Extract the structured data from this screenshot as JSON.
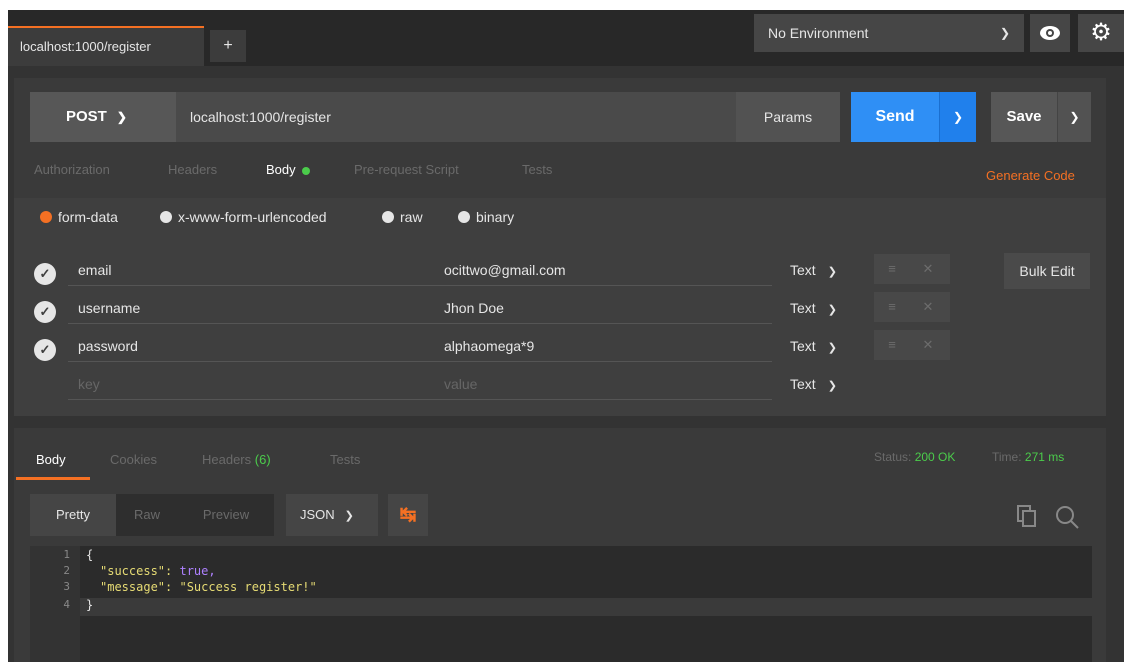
{
  "tabs": {
    "active_tab": "localhost:1000/register",
    "add_label": "+"
  },
  "environment": {
    "selected": "No Environment"
  },
  "request": {
    "method": "POST",
    "url": "localhost:1000/register",
    "params_label": "Params",
    "send_label": "Send",
    "save_label": "Save"
  },
  "request_tabs": [
    "Authorization",
    "Headers",
    "Body",
    "Pre-request Script",
    "Tests"
  ],
  "generate_code_label": "Generate Code",
  "body_modes": [
    "form-data",
    "x-www-form-urlencoded",
    "raw",
    "binary"
  ],
  "form_rows": [
    {
      "key": "email",
      "value": "ocittwo@gmail.com",
      "type": "Text"
    },
    {
      "key": "username",
      "value": "Jhon Doe",
      "type": "Text"
    },
    {
      "key": "password",
      "value": "alphaomega*9",
      "type": "Text"
    }
  ],
  "empty_row": {
    "key_placeholder": "key",
    "value_placeholder": "value",
    "type": "Text"
  },
  "bulk_edit_label": "Bulk Edit",
  "response": {
    "tabs": [
      "Body",
      "Cookies",
      "Headers",
      "Tests"
    ],
    "headers_count": "(6)",
    "status_label": "Status:",
    "status_value": "200 OK",
    "time_label": "Time:",
    "time_value": "271 ms",
    "view_modes": [
      "Pretty",
      "Raw",
      "Preview"
    ],
    "format": "JSON",
    "line_numbers": [
      "1",
      "2",
      "3",
      "4"
    ],
    "lines": [
      "{",
      "\"success\":",
      "true,",
      "\"message\":",
      "\"Success register!\"",
      "}"
    ]
  },
  "colors": {
    "accent": "#f47023",
    "send": "#2f8ff5",
    "success": "#4bcc4b"
  }
}
